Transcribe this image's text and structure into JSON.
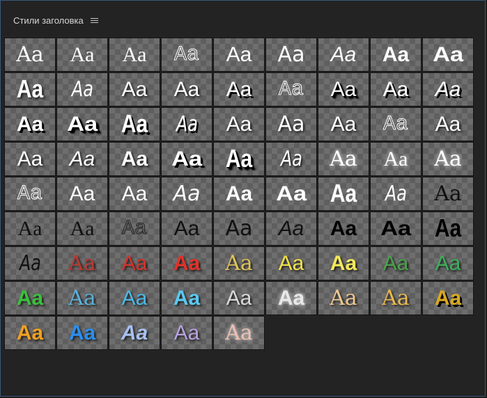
{
  "panel": {
    "title": "Стили заголовка",
    "menu_icon": "hamburger-menu-icon"
  },
  "sample_text": "Aa",
  "styles": [
    {
      "cls": "s-serif",
      "color": "#ffffff"
    },
    {
      "cls": "s-serifL",
      "color": "#ffffff"
    },
    {
      "cls": "s-serifL",
      "color": "#ffffff"
    },
    {
      "cls": "s-mono outline",
      "color": ""
    },
    {
      "cls": "s-sans",
      "color": "#ffffff"
    },
    {
      "cls": "s-dsans",
      "color": "#ffffff"
    },
    {
      "cls": "s-sans italic",
      "color": "#ffffff"
    },
    {
      "cls": "s-sans bold",
      "color": "#ffffff"
    },
    {
      "cls": "s-sans bold wide",
      "color": "#ffffff"
    },
    {
      "cls": "s-sans bold tall sh-soft",
      "color": "#ffffff"
    },
    {
      "cls": "s-dsans italic narrow",
      "color": "#ffffff"
    },
    {
      "cls": "s-sans sh-soft",
      "color": "#ffffff"
    },
    {
      "cls": "s-sans sh-soft",
      "color": "#ffffff"
    },
    {
      "cls": "s-sans sh-hard",
      "color": "#ffffff"
    },
    {
      "cls": "s-mono outline",
      "color": ""
    },
    {
      "cls": "s-sans sh-long",
      "color": "#ffffff"
    },
    {
      "cls": "s-sans sh-hard",
      "color": "#ffffff"
    },
    {
      "cls": "s-sans italic sh-hard",
      "color": "#ffffff"
    },
    {
      "cls": "s-sans bold sh-hard",
      "color": "#ffffff"
    },
    {
      "cls": "s-sans bold wide sh-long",
      "color": "#ffffff"
    },
    {
      "cls": "s-sans bold tall narrow sh-hard",
      "color": "#ffffff"
    },
    {
      "cls": "s-dsans italic narrow sh-hard",
      "color": "#ffffff"
    },
    {
      "cls": "s-sans sh-soft",
      "color": "#ffffff"
    },
    {
      "cls": "s-dsans sh-soft",
      "color": "#ffffff"
    },
    {
      "cls": "s-sans sh-soft",
      "color": "#ffffff"
    },
    {
      "cls": "s-mono outline",
      "color": ""
    },
    {
      "cls": "s-sans sh-soft",
      "color": "#ffffff"
    },
    {
      "cls": "s-sans sh-soft",
      "color": "#ffffff"
    },
    {
      "cls": "s-sans italic sh-soft",
      "color": "#ffffff"
    },
    {
      "cls": "s-sans bold sh-soft",
      "color": "#ffffff"
    },
    {
      "cls": "s-sans bold wide sh-hard",
      "color": "#ffffff"
    },
    {
      "cls": "s-sans bold tall narrow sh-long",
      "color": "#ffffff"
    },
    {
      "cls": "s-dsans italic narrow sh-soft",
      "color": "#ffffff"
    },
    {
      "cls": "s-serif glow",
      "color": "#ffffff"
    },
    {
      "cls": "s-serifL glow",
      "color": "#ffffff"
    },
    {
      "cls": "s-serif glow",
      "color": "#ffffff"
    },
    {
      "cls": "s-mono outline",
      "color": ""
    },
    {
      "cls": "s-sans",
      "color": "#ffffff"
    },
    {
      "cls": "s-sans",
      "color": "#ffffff"
    },
    {
      "cls": "s-dsans italic",
      "color": "#ffffff"
    },
    {
      "cls": "s-sans bold",
      "color": "#ffffff"
    },
    {
      "cls": "s-sans bold wide",
      "color": "#ffffff"
    },
    {
      "cls": "s-sans bold tall narrow",
      "color": "#ffffff"
    },
    {
      "cls": "s-dsans italic narrow",
      "color": "#ffffff"
    },
    {
      "cls": "s-serif dark",
      "color": "#111111"
    },
    {
      "cls": "s-serifL dark",
      "color": "#111111"
    },
    {
      "cls": "s-serifL dark",
      "color": "#111111"
    },
    {
      "cls": "s-mono outline-dark",
      "color": ""
    },
    {
      "cls": "s-sans dark",
      "color": "#111111"
    },
    {
      "cls": "s-dsans dark",
      "color": "#111111"
    },
    {
      "cls": "s-sans italic dark",
      "color": "#111111"
    },
    {
      "cls": "s-sans bold blk",
      "color": "#000000"
    },
    {
      "cls": "s-sans bold wide blk",
      "color": "#000000"
    },
    {
      "cls": "s-sans bold tall narrow blk",
      "color": "#000000"
    },
    {
      "cls": "s-dsans italic narrow",
      "color": "#111111"
    },
    {
      "cls": "s-serif sh-soft",
      "color": "#b93a32"
    },
    {
      "cls": "s-sans sh-soft",
      "color": "#d8322a"
    },
    {
      "cls": "s-sans bold sh-soft",
      "color": "#e2322a"
    },
    {
      "cls": "s-serif sh-soft",
      "color": "#e0c25a"
    },
    {
      "cls": "s-sans sh-soft",
      "color": "#f0e04a"
    },
    {
      "cls": "s-sans bold sh-soft",
      "color": "#f2e85a"
    },
    {
      "cls": "s-sans sh-soft",
      "color": "#4aa24a"
    },
    {
      "cls": "s-sans sh-soft",
      "color": "#3cb05a"
    },
    {
      "cls": "s-sans bold sh-soft",
      "color": "#3cc03c"
    },
    {
      "cls": "s-serif sh-soft",
      "color": "#5ab0d8"
    },
    {
      "cls": "s-sans sh-soft",
      "color": "#4ab8e8"
    },
    {
      "cls": "s-sans bold sh-soft",
      "color": "#5ac8f0"
    },
    {
      "cls": "s-sans sh-soft",
      "color": "#d8d8d8"
    },
    {
      "cls": "s-sans bold glow",
      "color": "#e8e8e8"
    },
    {
      "cls": "s-serif sh-soft",
      "color": "#f0c890"
    },
    {
      "cls": "s-serif sh-soft",
      "color": "#e8b850"
    },
    {
      "cls": "s-sans bold sh-hard",
      "color": "#d8a820"
    },
    {
      "cls": "s-sans bold sh-soft",
      "color": "#f0a020"
    },
    {
      "cls": "s-sans bold sh-soft",
      "color": "#2a8ef0"
    },
    {
      "cls": "s-sans italic bold sh-soft",
      "color": "#a8c0f0"
    },
    {
      "cls": "s-sans sh-soft",
      "color": "#b8a0e0"
    },
    {
      "cls": "s-serif glow",
      "color": "#f0c0b0"
    }
  ]
}
